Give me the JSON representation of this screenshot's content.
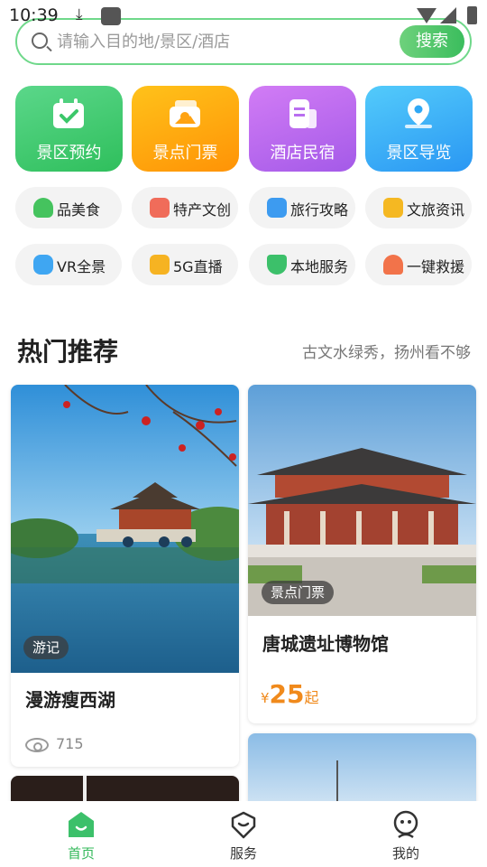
{
  "status_bar": {
    "time": "10:39"
  },
  "search": {
    "placeholder": "请输入目的地/景区/酒店",
    "button": "搜索"
  },
  "tiles": [
    {
      "label": "景区预约",
      "color": "#3cc76a",
      "icon": "calendar-check-icon"
    },
    {
      "label": "景点门票",
      "color": "#ff9f0a",
      "icon": "ticket-icon"
    },
    {
      "label": "酒店民宿",
      "color": "#b96ef0",
      "icon": "hotel-icon"
    },
    {
      "label": "景区导览",
      "color": "#2fa8f5",
      "icon": "map-pin-icon"
    }
  ],
  "chips_row1": [
    {
      "label": "品美食",
      "color": "#45c35e",
      "icon": "food-icon"
    },
    {
      "label": "特产文创",
      "color": "#f06c5a",
      "icon": "gift-icon"
    },
    {
      "label": "旅行攻略",
      "color": "#3d9bf0",
      "icon": "book-icon"
    },
    {
      "label": "文旅资讯",
      "color": "#f5b822",
      "icon": "news-icon"
    }
  ],
  "chips_row2": [
    {
      "label": "VR全景",
      "color": "#3fa6f2",
      "icon": "vr-icon"
    },
    {
      "label": "5G直播",
      "color": "#f6b322",
      "icon": "live-icon"
    },
    {
      "label": "本地服务",
      "color": "#3cc06a",
      "icon": "heart-icon"
    },
    {
      "label": "一键救援",
      "color": "#f2734a",
      "icon": "alarm-icon"
    }
  ],
  "section": {
    "title": "热门推荐",
    "subtitle": "古文水绿秀，扬州看不够"
  },
  "cards": {
    "left": {
      "tag": "游记",
      "title": "漫游瘦西湖",
      "views": "715"
    },
    "right": {
      "tag": "景点门票",
      "title": "唐城遗址博物馆",
      "currency": "¥",
      "price": "25",
      "price_suffix": "起"
    }
  },
  "tabbar": [
    {
      "label": "首页",
      "icon": "home-icon",
      "active": true
    },
    {
      "label": "服务",
      "icon": "service-icon",
      "active": false
    },
    {
      "label": "我的",
      "icon": "profile-icon",
      "active": false
    }
  ],
  "colors": {
    "accent": "#33b85a",
    "price": "#f08a1c"
  }
}
